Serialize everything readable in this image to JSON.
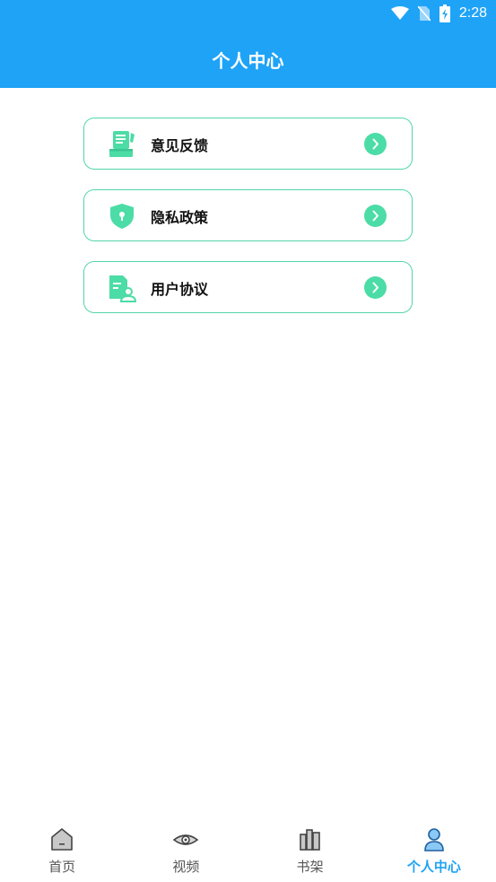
{
  "status_bar": {
    "time": "2:28"
  },
  "header": {
    "title": "个人中心"
  },
  "menu": [
    {
      "label": "意见反馈",
      "icon": "feedback-icon"
    },
    {
      "label": "隐私政策",
      "icon": "shield-lock-icon"
    },
    {
      "label": "用户协议",
      "icon": "user-agreement-icon"
    }
  ],
  "bottom_nav": [
    {
      "label": "首页",
      "icon": "home-icon"
    },
    {
      "label": "视频",
      "icon": "eye-icon"
    },
    {
      "label": "书架",
      "icon": "bookshelf-icon"
    },
    {
      "label": "个人中心",
      "icon": "person-icon",
      "active": true
    }
  ],
  "colors": {
    "primary": "#1fa3f7",
    "accent": "#4cdca6",
    "border": "#54d6a8"
  }
}
